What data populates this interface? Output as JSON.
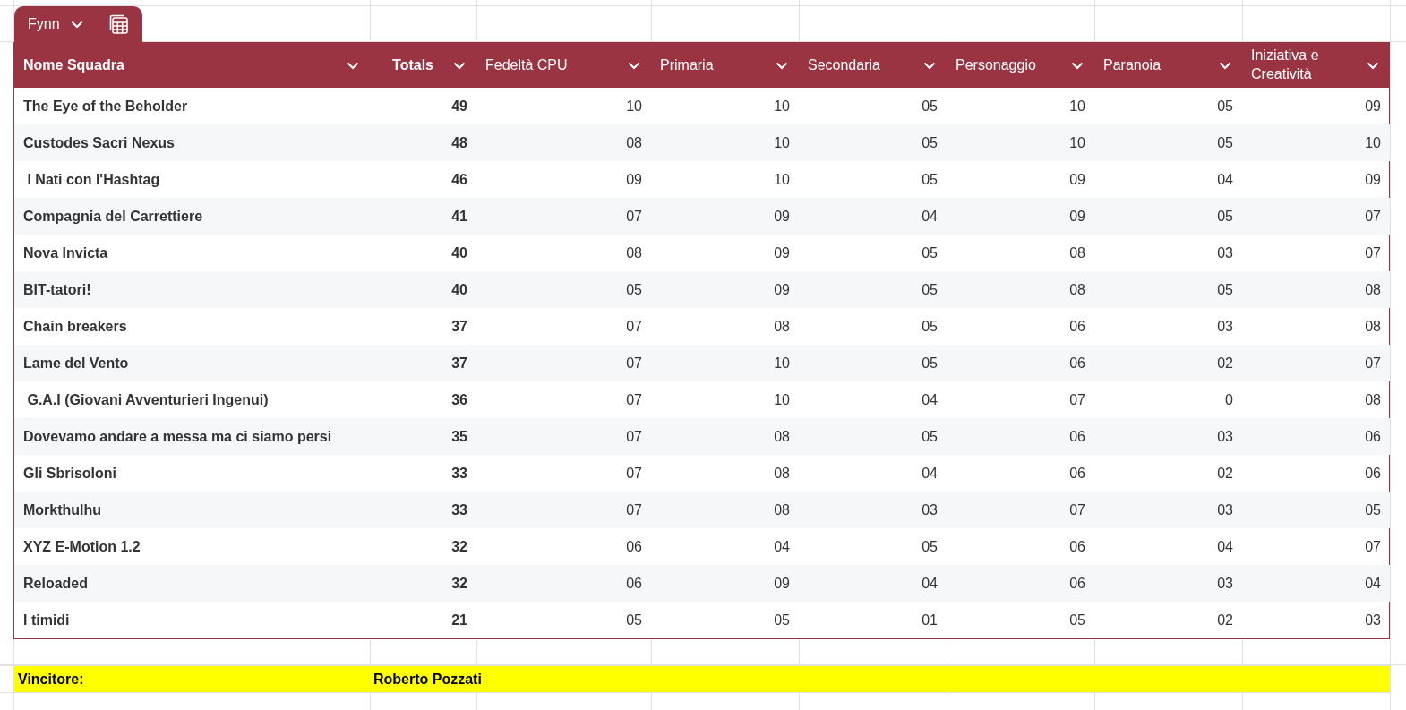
{
  "table_tab": {
    "label": "Fynn"
  },
  "table": {
    "columns": [
      {
        "label": "Nome Squadra",
        "bold": true
      },
      {
        "label": "Totals",
        "bold": true
      },
      {
        "label": "Fedeltà CPU",
        "bold": false
      },
      {
        "label": "Primaria",
        "bold": false
      },
      {
        "label": "Secondaria",
        "bold": false
      },
      {
        "label": "Personaggio",
        "bold": false
      },
      {
        "label": "Paranoia",
        "bold": false
      },
      {
        "label": "Iniziativa e Creatività",
        "bold": false
      }
    ],
    "rows": [
      [
        "The Eye of the Beholder",
        "49",
        "10",
        "10",
        "05",
        "10",
        "05",
        "09"
      ],
      [
        "Custodes Sacri Nexus",
        "48",
        "08",
        "10",
        "05",
        "10",
        "05",
        "10"
      ],
      [
        " I Nati con l'Hashtag",
        "46",
        "09",
        "10",
        "05",
        "09",
        "04",
        "09"
      ],
      [
        "Compagnia del Carrettiere",
        "41",
        "07",
        "09",
        "04",
        "09",
        "05",
        "07"
      ],
      [
        "Nova Invicta",
        "40",
        "08",
        "09",
        "05",
        "08",
        "03",
        "07"
      ],
      [
        "BIT-tatori!",
        "40",
        "05",
        "09",
        "05",
        "08",
        "05",
        "08"
      ],
      [
        "Chain breakers",
        "37",
        "07",
        "08",
        "05",
        "06",
        "03",
        "08"
      ],
      [
        "Lame del Vento",
        "37",
        "07",
        "10",
        "05",
        "06",
        "02",
        "07"
      ],
      [
        " G.A.I (Giovani Avventurieri Ingenui)",
        "36",
        "07",
        "10",
        "04",
        "07",
        "0",
        "08"
      ],
      [
        "Dovevamo andare a messa ma ci siamo persi",
        "35",
        "07",
        "08",
        "05",
        "06",
        "03",
        "06"
      ],
      [
        "Gli Sbrisoloni",
        "33",
        "07",
        "08",
        "04",
        "06",
        "02",
        "06"
      ],
      [
        "Morkthulhu",
        "33",
        "07",
        "08",
        "03",
        "07",
        "03",
        "05"
      ],
      [
        "XYZ E-Motion 1.2",
        "32",
        "06",
        "04",
        "05",
        "06",
        "04",
        "07"
      ],
      [
        "Reloaded",
        "32",
        "06",
        "09",
        "04",
        "06",
        "03",
        "04"
      ],
      [
        "I timidi",
        "21",
        "05",
        "05",
        "01",
        "05",
        "02",
        "03"
      ]
    ]
  },
  "winner_row": {
    "label": "Vincitore:",
    "value": "Roberto Pozzati"
  }
}
